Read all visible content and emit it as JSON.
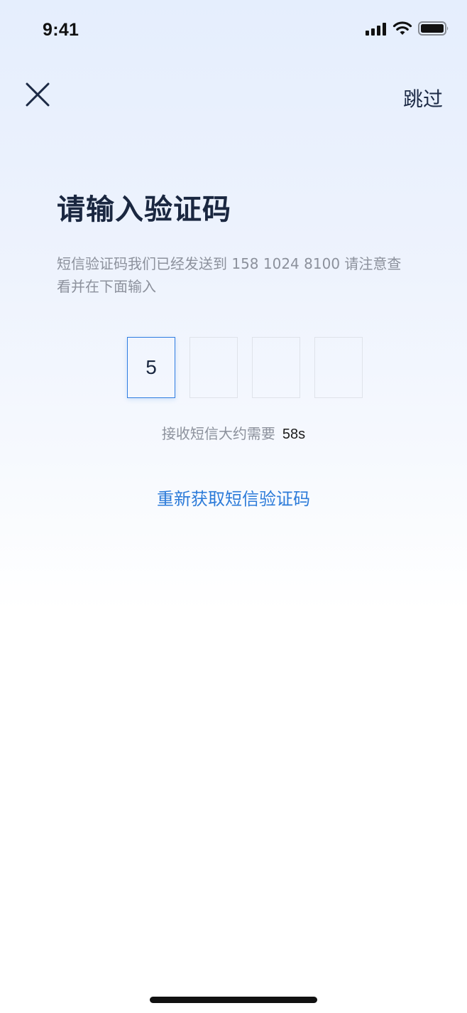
{
  "status_bar": {
    "time": "9:41"
  },
  "nav": {
    "skip_label": "跳过"
  },
  "content": {
    "title": "请输入验证码",
    "description": "短信验证码我们已经发送到 158 1024 8100 请注意查看并在下面输入",
    "code_digits": [
      "5",
      "",
      "",
      ""
    ],
    "countdown_label": "接收短信大约需要",
    "countdown_value": "58s",
    "resend_label": "重新获取短信验证码"
  },
  "colors": {
    "accent": "#2c7bd9",
    "title": "#1a2740",
    "secondary_text": "#8c919c"
  },
  "icons": {
    "close": "close-icon",
    "signal": "cellular-signal-icon",
    "wifi": "wifi-icon",
    "battery": "battery-icon"
  }
}
